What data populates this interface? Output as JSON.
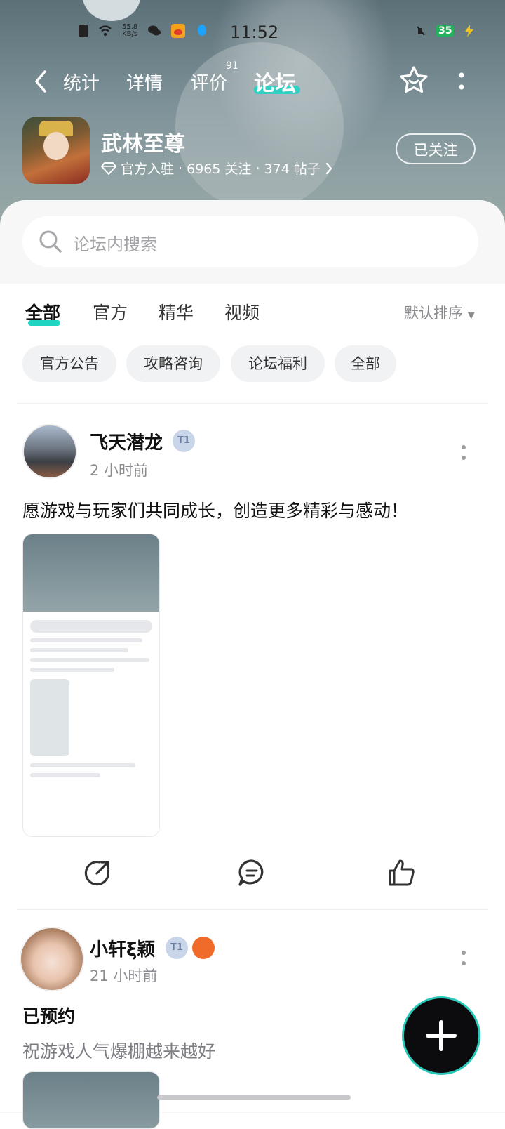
{
  "status_bar": {
    "time": "11:52",
    "net_speed_value": "55.8",
    "net_speed_unit": "KB/s",
    "battery": "35"
  },
  "nav": {
    "tabs": [
      {
        "label": "统计"
      },
      {
        "label": "详情"
      },
      {
        "label": "评价",
        "badge": "91"
      },
      {
        "label": "论坛"
      }
    ],
    "active_tab": "论坛"
  },
  "game": {
    "name": "武林至尊",
    "official": "官方入驻",
    "followers": "6965 关注",
    "posts": "374 帖子",
    "follow_label": "已关注"
  },
  "search": {
    "placeholder": "论坛内搜索"
  },
  "filter_tabs": [
    "全部",
    "官方",
    "精华",
    "视频"
  ],
  "sort_label": "默认排序",
  "chips": [
    "官方公告",
    "攻略咨询",
    "论坛福利",
    "全部"
  ],
  "posts": [
    {
      "user": "飞天潜龙",
      "time": "2 小时前",
      "text": "愿游戏与玩家们共同成长，创造更多精彩与感动！"
    },
    {
      "user": "小轩ξ颖",
      "time": "21 小时前",
      "title": "已预约",
      "text": "祝游戏人气爆棚越来越好"
    }
  ],
  "colors": {
    "accent": "#20d4c2",
    "hero_bg": "#7d9198",
    "sheet_bg": "#f7f7f8"
  }
}
